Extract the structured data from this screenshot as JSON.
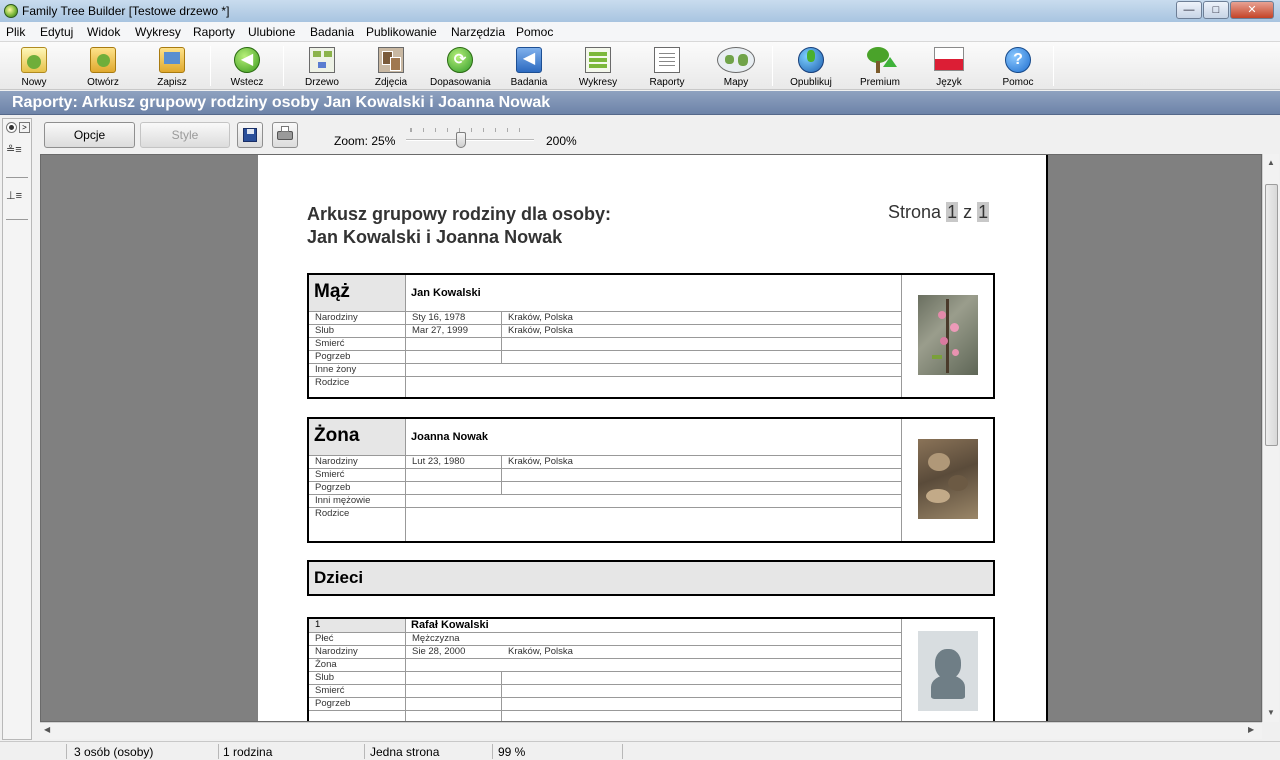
{
  "window": {
    "title": "Family Tree Builder [Testowe drzewo *]",
    "min": "—",
    "max": "□",
    "close": "✕"
  },
  "menu": [
    "Plik",
    "Edytuj",
    "Widok",
    "Wykresy",
    "Raporty",
    "Ulubione",
    "Badania",
    "Publikowanie",
    "Narzędzia",
    "Pomoc"
  ],
  "toolbar": {
    "nowy": "Nowy",
    "otworz": "Otwórz",
    "zapisz": "Zapisz",
    "wstecz": "Wstecz",
    "drzewo": "Drzewo",
    "zdjecia": "Zdjęcia",
    "dopasowania": "Dopasowania",
    "badania": "Badania",
    "wykresy": "Wykresy",
    "raporty": "Raporty",
    "mapy": "Mapy",
    "opublikuj": "Opublikuj",
    "premium": "Premium",
    "jezyk": "Język",
    "pomoc": "Pomoc"
  },
  "header": "Raporty: Arkusz grupowy rodziny osoby Jan Kowalski i Joanna Nowak",
  "subbar": {
    "opcje": "Opcje",
    "style": "Style",
    "zoom_label": "Zoom: 25%",
    "zoom_max": "200%"
  },
  "report": {
    "title1": "Arkusz grupowy rodziny dla osoby:",
    "title2": "Jan Kowalski i Joanna Nowak",
    "page_word": "Strona",
    "page_num": "1",
    "page_of": "z",
    "page_total": "1",
    "husband": {
      "heading": "Mąż",
      "name": "Jan Kowalski",
      "rows": [
        {
          "label": "Narodziny",
          "date": "Sty 16, 1978",
          "place": "Kraków, Polska"
        },
        {
          "label": "Slub",
          "date": "Mar 27, 1999",
          "place": "Kraków, Polska"
        },
        {
          "label": "Smierć",
          "date": "",
          "place": ""
        },
        {
          "label": "Pogrzeb",
          "date": "",
          "place": ""
        },
        {
          "label": "Inne żony",
          "date": "",
          "place": ""
        },
        {
          "label": "Rodzice",
          "date": "",
          "place": ""
        }
      ]
    },
    "wife": {
      "heading": "Żona",
      "name": "Joanna Nowak",
      "rows": [
        {
          "label": "Narodziny",
          "date": "Lut 23, 1980",
          "place": "Kraków, Polska"
        },
        {
          "label": "Smierć",
          "date": "",
          "place": ""
        },
        {
          "label": "Pogrzeb",
          "date": "",
          "place": ""
        },
        {
          "label": "Inni mężowie",
          "date": "",
          "place": ""
        },
        {
          "label": "Rodzice",
          "date": "",
          "place": ""
        }
      ]
    },
    "children_heading": "Dzieci",
    "child": {
      "num": "1",
      "name": "Rafał Kowalski",
      "rows": [
        {
          "label": "Płeć",
          "date": "Mężczyzna",
          "place": ""
        },
        {
          "label": "Narodziny",
          "date": "Sie 28, 2000",
          "place": "Kraków, Polska"
        },
        {
          "label": "Żona",
          "date": "",
          "place": ""
        },
        {
          "label": "Slub",
          "date": "",
          "place": ""
        },
        {
          "label": "Smierć",
          "date": "",
          "place": ""
        },
        {
          "label": "Pogrzeb",
          "date": "",
          "place": ""
        }
      ]
    }
  },
  "status": {
    "persons": "3 osób (osoby)",
    "families": "1 rodzina",
    "pages": "Jedna strona",
    "zoom": "99 %"
  }
}
